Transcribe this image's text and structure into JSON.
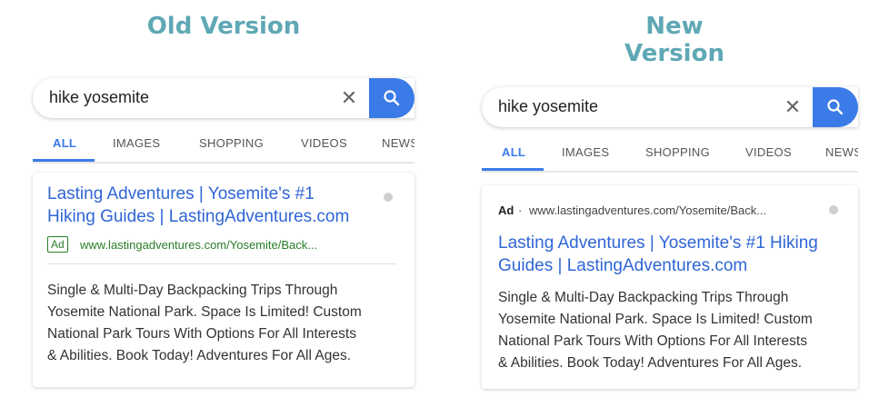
{
  "old": {
    "heading": "Old Version",
    "query": "hike yosemite",
    "tabs": [
      "ALL",
      "IMAGES",
      "SHOPPING",
      "VIDEOS",
      "NEWS"
    ],
    "ad": {
      "title_line1": "Lasting Adventures | Yosemite's #1",
      "title_line2": "Hiking Guides | LastingAdventures.com",
      "badge": "Ad",
      "url": "www.lastingadventures.com/Yosemite/Back...",
      "desc_line1": "Single & Multi-Day Backpacking Trips Through",
      "desc_line2": "Yosemite National Park. Space Is Limited! Custom",
      "desc_line3": "National Park Tours With Options For All Interests",
      "desc_line4": "& Abilities. Book Today! Adventures For All Ages."
    }
  },
  "new": {
    "heading": "New Version",
    "query": "hike yosemite",
    "tabs": [
      "ALL",
      "IMAGES",
      "SHOPPING",
      "VIDEOS",
      "NEWS"
    ],
    "ad": {
      "badge": "Ad",
      "separator": "·",
      "url": "www.lastingadventures.com/Yosemite/Back...",
      "title_line1": "Lasting Adventures | Yosemite's #1 Hiking",
      "title_line2": "Guides | LastingAdventures.com",
      "desc_line1": "Single & Multi-Day Backpacking Trips Through",
      "desc_line2": "Yosemite National Park. Space Is Limited! Custom",
      "desc_line3": "National Park Tours With Options For All Interests",
      "desc_line4": "& Abilities. Book Today! Adventures For All Ages."
    }
  },
  "colors": {
    "heading": "#5fa8b5",
    "accent_blue": "#3b7be8",
    "link_blue": "#2f66d6",
    "ad_green": "#2a7d2a"
  },
  "icons": {
    "clear": "close-icon",
    "search": "search-icon",
    "info": "info-dot-icon"
  }
}
